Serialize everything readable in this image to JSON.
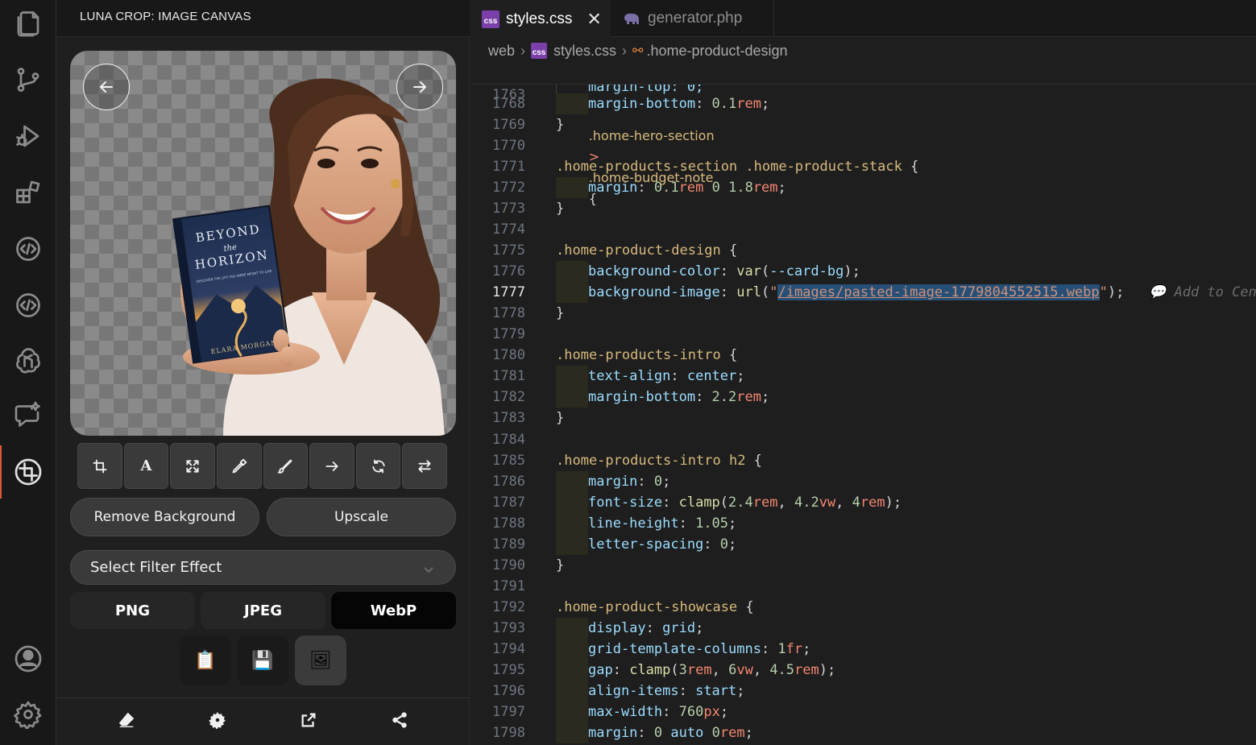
{
  "panel": {
    "title": "LUNA CROP: IMAGE CANVAS",
    "book": {
      "title_line1": "BEYOND",
      "title_line2": "the",
      "title_line3": "HORIZON",
      "subtitle": "DISCOVER THE LIFE YOU WERE MEANT TO LIVE",
      "author": "ELARA MORGAN"
    },
    "actions": {
      "remove_bg": "Remove Background",
      "upscale": "Upscale"
    },
    "filter": {
      "placeholder": "Select Filter Effect"
    },
    "formats": [
      {
        "label": "PNG",
        "active": false
      },
      {
        "label": "JPEG",
        "active": false
      },
      {
        "label": "WebP",
        "active": true
      }
    ],
    "icon_buttons": [
      {
        "name": "clipboard-icon",
        "glyph": "📋"
      },
      {
        "name": "save-icon",
        "glyph": "💾"
      },
      {
        "name": "export-image-icon",
        "glyph": "🖼"
      }
    ]
  },
  "tabs": [
    {
      "label": "styles.css",
      "badge": "css",
      "active": true
    },
    {
      "label": "generator.php",
      "badge": "php",
      "active": false
    }
  ],
  "breadcrumb": {
    "folder": "web",
    "file": "styles.css",
    "symbol": ".home-product-design"
  },
  "editor": {
    "sticky": {
      "line": "1763",
      "selector_a": ".home-hero-section",
      "combinator": ">",
      "selector_b": ".home-budget-note",
      "brace": "{"
    },
    "peek_line": "margin-top: 0;",
    "hint": "Add to Cen",
    "url_value": "/images/pasted-image-1779804552515.webp"
  },
  "colors": {
    "accent": "#e0573a",
    "css_badge": "#7a3fa8"
  }
}
